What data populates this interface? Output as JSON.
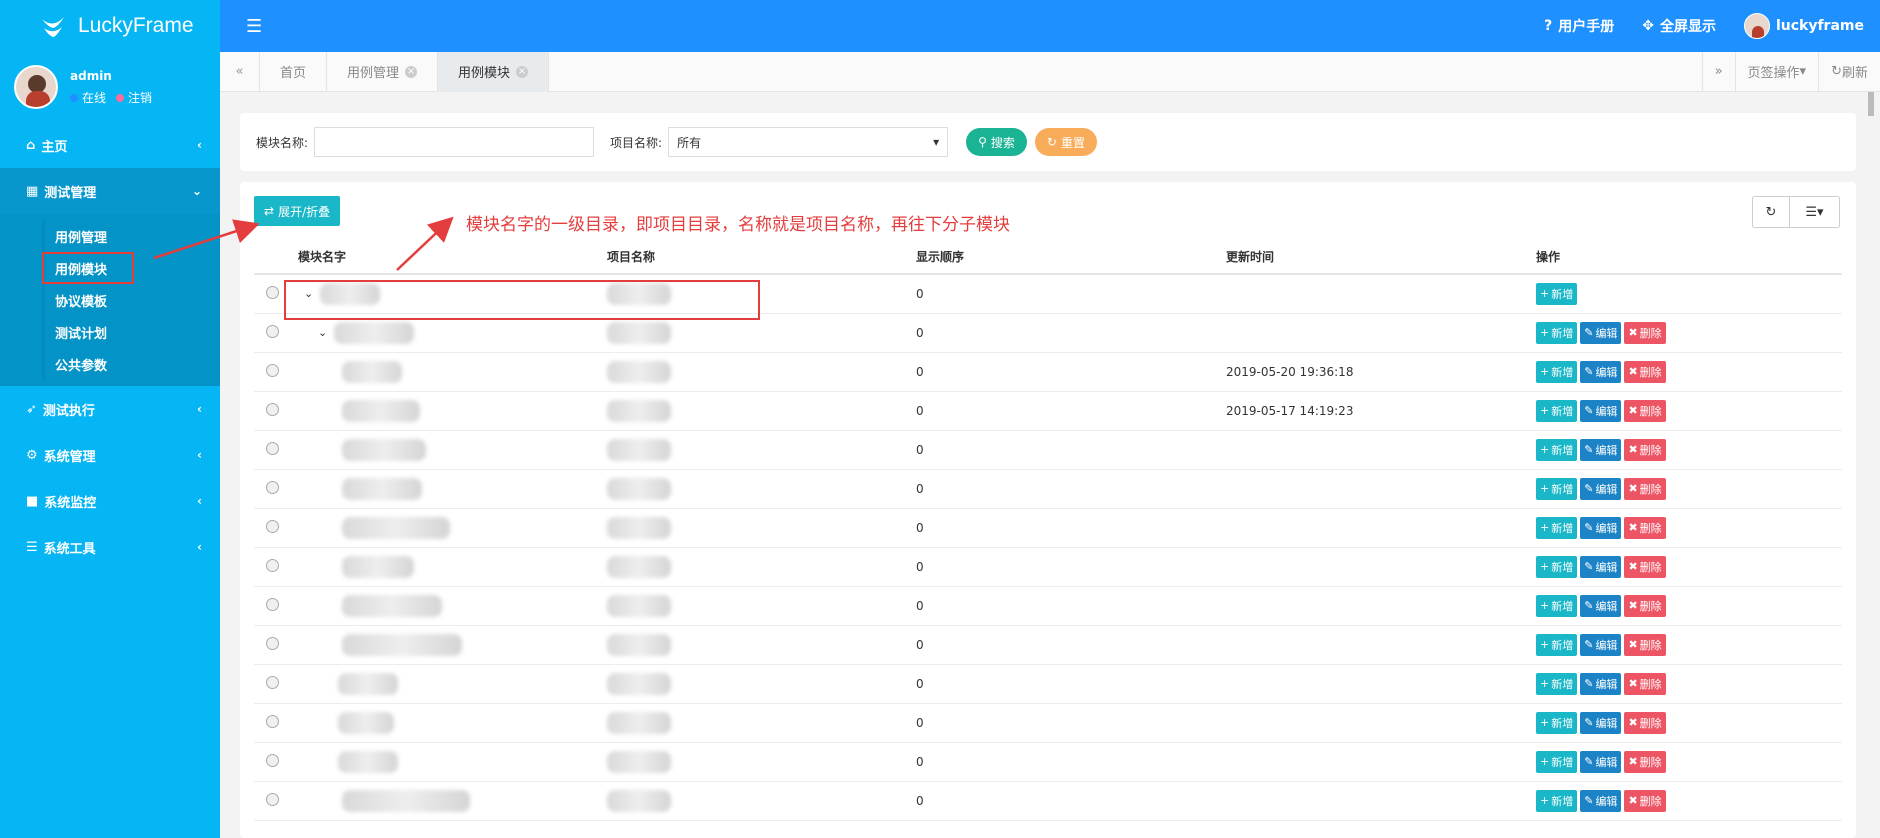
{
  "app": {
    "name": "LuckyFrame",
    "accent": "#1e90ff",
    "sidebar_color": "#05b5f4"
  },
  "user": {
    "name": "admin",
    "status_online": "在线",
    "logout": "注销"
  },
  "sidebar": {
    "items": [
      {
        "label": "主页",
        "icon": "home-icon"
      },
      {
        "label": "测试管理",
        "icon": "grid-icon"
      },
      {
        "label": "测试执行",
        "icon": "rocket-icon"
      },
      {
        "label": "系统管理",
        "icon": "gear-icon"
      },
      {
        "label": "系统监控",
        "icon": "camera-icon"
      },
      {
        "label": "系统工具",
        "icon": "list-icon"
      }
    ],
    "submenu": [
      "用例管理",
      "用例模块",
      "协议模板",
      "测试计划",
      "公共参数"
    ]
  },
  "topbar": {
    "manual": "用户手册",
    "fullscreen": "全屏显示",
    "username": "luckyframe"
  },
  "tabs": {
    "items": [
      "首页",
      "用例管理",
      "用例模块"
    ],
    "tab_ops": "页签操作",
    "refresh": "刷新"
  },
  "search": {
    "module_label": "模块名称:",
    "module_value": "",
    "project_label": "项目名称:",
    "project_value": "所有",
    "search_btn": "搜索",
    "reset_btn": "重置"
  },
  "toolbar": {
    "toggle_label": "展开/折叠"
  },
  "annotation": {
    "text": "模块名字的一级目录，即项目目录，名称就是项目名称，再往下分子模块"
  },
  "table": {
    "columns": [
      "模块名字",
      "项目名称",
      "显示顺序",
      "更新时间",
      "操作"
    ],
    "actions": {
      "add": "新增",
      "edit": "编辑",
      "delete": "删除"
    },
    "rows": [
      {
        "order": "0",
        "updated": "",
        "actions": [
          "add"
        ]
      },
      {
        "order": "0",
        "updated": "",
        "actions": [
          "add",
          "edit",
          "delete"
        ]
      },
      {
        "order": "0",
        "updated": "2019-05-20 19:36:18",
        "actions": [
          "add",
          "edit",
          "delete"
        ]
      },
      {
        "order": "0",
        "updated": "2019-05-17 14:19:23",
        "actions": [
          "add",
          "edit",
          "delete"
        ]
      },
      {
        "order": "0",
        "updated": "",
        "actions": [
          "add",
          "edit",
          "delete"
        ]
      },
      {
        "order": "0",
        "updated": "",
        "actions": [
          "add",
          "edit",
          "delete"
        ]
      },
      {
        "order": "0",
        "updated": "",
        "actions": [
          "add",
          "edit",
          "delete"
        ]
      },
      {
        "order": "0",
        "updated": "",
        "actions": [
          "add",
          "edit",
          "delete"
        ]
      },
      {
        "order": "0",
        "updated": "",
        "actions": [
          "add",
          "edit",
          "delete"
        ]
      },
      {
        "order": "0",
        "updated": "",
        "actions": [
          "add",
          "edit",
          "delete"
        ]
      },
      {
        "order": "0",
        "updated": "",
        "actions": [
          "add",
          "edit",
          "delete"
        ]
      },
      {
        "order": "0",
        "updated": "",
        "actions": [
          "add",
          "edit",
          "delete"
        ]
      },
      {
        "order": "0",
        "updated": "",
        "actions": [
          "add",
          "edit",
          "delete"
        ]
      },
      {
        "order": "0",
        "updated": "",
        "actions": [
          "add",
          "edit",
          "delete"
        ]
      }
    ]
  }
}
